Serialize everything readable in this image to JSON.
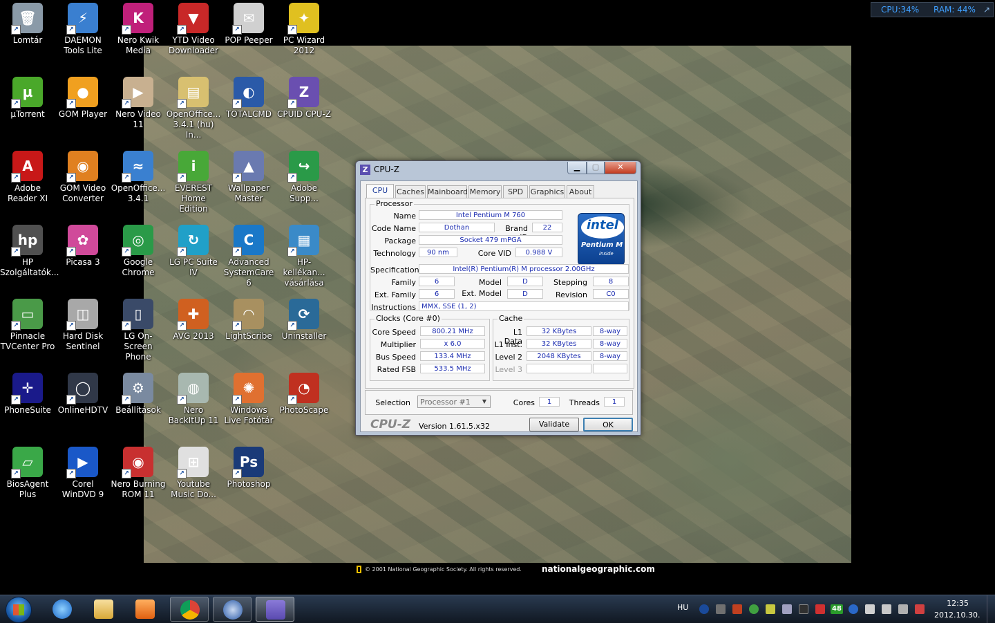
{
  "gadget": {
    "cpu": "CPU:34%",
    "ram": "RAM: 44%",
    "arrow": "↗"
  },
  "desktop_icons": [
    {
      "label": "Lomtár",
      "color": "#8a9aa8",
      "glyph": "🗑"
    },
    {
      "label": "DAEMON Tools Lite",
      "color": "#3a7fd0",
      "glyph": "⚡"
    },
    {
      "label": "Nero Kwik Media",
      "color": "#c0207a",
      "glyph": "K"
    },
    {
      "label": "YTD Video Downloader",
      "color": "#c82828",
      "glyph": "▼"
    },
    {
      "label": "POP Peeper",
      "color": "#d0d0d0",
      "glyph": "✉"
    },
    {
      "label": "PC Wizard 2012",
      "color": "#e0c020",
      "glyph": "✦"
    },
    {
      "label": "µTorrent",
      "color": "#4aa82a",
      "glyph": "µ"
    },
    {
      "label": "GOM Player",
      "color": "#f0a020",
      "glyph": "●"
    },
    {
      "label": "Nero Video 11",
      "color": "#c8b090",
      "glyph": "▶"
    },
    {
      "label": "OpenOffice... 3.4.1 (hu) In...",
      "color": "#d8c070",
      "glyph": "▤"
    },
    {
      "label": "TOTALCMD",
      "color": "#2a5aa8",
      "glyph": "◐"
    },
    {
      "label": "CPUID CPU-Z",
      "color": "#6a4fb0",
      "glyph": "Z"
    },
    {
      "label": "Adobe Reader XI",
      "color": "#c81818",
      "glyph": "A"
    },
    {
      "label": "GOM Video Converter",
      "color": "#e08020",
      "glyph": "◉"
    },
    {
      "label": "OpenOffice... 3.4.1",
      "color": "#3a80d0",
      "glyph": "≈"
    },
    {
      "label": "EVEREST Home Edition",
      "color": "#48a838",
      "glyph": "i"
    },
    {
      "label": "Wallpaper Master",
      "color": "#6a7ab0",
      "glyph": "▲"
    },
    {
      "label": "Adobe Supp...",
      "color": "#2a9a48",
      "glyph": "↪"
    },
    {
      "label": "HP Szolgáltatók...",
      "color": "#505050",
      "glyph": "hp"
    },
    {
      "label": "Picasa 3",
      "color": "#d04a9a",
      "glyph": "✿"
    },
    {
      "label": "Google Chrome",
      "color": "#2a9a48",
      "glyph": "◎"
    },
    {
      "label": "LG PC Suite IV",
      "color": "#20a0c8",
      "glyph": "↻"
    },
    {
      "label": "Advanced SystemCare 6",
      "color": "#1a78c8",
      "glyph": "C"
    },
    {
      "label": "HP-kellékan... vásárlása",
      "color": "#3a8ac8",
      "glyph": "▦"
    },
    {
      "label": "Pinnacle TVCenter Pro",
      "color": "#4a9a48",
      "glyph": "▭"
    },
    {
      "label": "Hard Disk Sentinel",
      "color": "#a8a8a8",
      "glyph": "◫"
    },
    {
      "label": "LG On-Screen Phone",
      "color": "#3a4a68",
      "glyph": "▯"
    },
    {
      "label": "AVG 2013",
      "color": "#d06020",
      "glyph": "✚"
    },
    {
      "label": "LightScribe",
      "color": "#a89060",
      "glyph": "◠"
    },
    {
      "label": "Uninstaller",
      "color": "#2a6a98",
      "glyph": "⟳"
    },
    {
      "label": "PhoneSuite",
      "color": "#1a1a8a",
      "glyph": "✛"
    },
    {
      "label": "OnlineHDTV",
      "color": "#303848",
      "glyph": "◯"
    },
    {
      "label": "Beállítások",
      "color": "#7a8aa0",
      "glyph": "⚙"
    },
    {
      "label": "Nero BackItUp 11",
      "color": "#a8b8b0",
      "glyph": "◍"
    },
    {
      "label": "Windows Live Fotótár",
      "color": "#e07030",
      "glyph": "✺"
    },
    {
      "label": "PhotoScape",
      "color": "#c03020",
      "glyph": "◔"
    },
    {
      "label": "BiosAgent Plus",
      "color": "#3aa848",
      "glyph": "▱"
    },
    {
      "label": "Corel WinDVD 9",
      "color": "#1a58c8",
      "glyph": "▶"
    },
    {
      "label": "Nero Burning ROM 11",
      "color": "#c83030",
      "glyph": "◉"
    },
    {
      "label": "Youtube Music Do...",
      "color": "#e0e0e0",
      "glyph": "⊞"
    },
    {
      "label": "Photoshop",
      "color": "#1a3a78",
      "glyph": "Ps"
    }
  ],
  "wallpaper": {
    "copyright": "© 2001 National Geographic Society. All rights reserved.",
    "url": "nationalgeographic.com"
  },
  "cpuz": {
    "title": "CPU-Z",
    "tabs": [
      "CPU",
      "Caches",
      "Mainboard",
      "Memory",
      "SPD",
      "Graphics",
      "About"
    ],
    "processor": {
      "group": "Processor",
      "name_label": "Name",
      "name": "Intel Pentium M 760",
      "codename_label": "Code Name",
      "codename": "Dothan",
      "brandid_label": "Brand ID",
      "brandid": "22",
      "package_label": "Package",
      "package": "Socket 479 mPGA",
      "technology_label": "Technology",
      "technology": "90 nm",
      "corevid_label": "Core VID",
      "corevid": "0.988 V",
      "spec_label": "Specification",
      "spec": "Intel(R) Pentium(R) M processor 2.00GHz",
      "family_label": "Family",
      "family": "6",
      "model_label": "Model",
      "model": "D",
      "stepping_label": "Stepping",
      "stepping": "8",
      "extfamily_label": "Ext. Family",
      "extfamily": "6",
      "extmodel_label": "Ext. Model",
      "extmodel": "D",
      "revision_label": "Revision",
      "revision": "C0",
      "instructions_label": "Instructions",
      "instructions": "MMX, SSE (1, 2)",
      "logo_word": "intel",
      "logo_sub": "Pentium M",
      "logo_inside": "inside"
    },
    "clocks": {
      "group": "Clocks (Core #0)",
      "core_speed_label": "Core Speed",
      "core_speed": "800.21 MHz",
      "multiplier_label": "Multiplier",
      "multiplier": "x 6.0",
      "bus_speed_label": "Bus Speed",
      "bus_speed": "133.4 MHz",
      "rated_fsb_label": "Rated FSB",
      "rated_fsb": "533.5 MHz"
    },
    "cache": {
      "group": "Cache",
      "l1d_label": "L1 Data",
      "l1d": "32 KBytes",
      "l1d_way": "8-way",
      "l1i_label": "L1 Inst.",
      "l1i": "32 KBytes",
      "l1i_way": "8-way",
      "l2_label": "Level 2",
      "l2": "2048 KBytes",
      "l2_way": "8-way",
      "l3_label": "Level 3"
    },
    "selection_label": "Selection",
    "selection": "Processor #1",
    "cores_label": "Cores",
    "cores": "1",
    "threads_label": "Threads",
    "threads": "1",
    "brand": "CPU-Z",
    "version": "Version 1.61.5.x32",
    "validate": "Validate",
    "ok": "OK"
  },
  "taskbar": {
    "lang": "HU",
    "tray_badge": "48",
    "time": "12:35",
    "date": "2012.10.30."
  }
}
